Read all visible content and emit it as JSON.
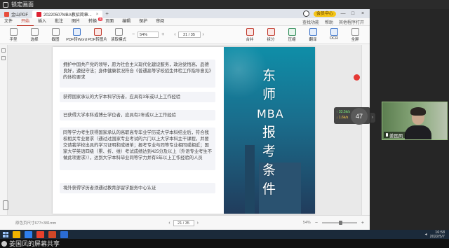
{
  "meeting": {
    "lock_label": "锁定画面",
    "presenter_footer": "姜国凤的屏幕共享"
  },
  "app": {
    "tabs": [
      {
        "label": "金山PDF",
        "active": false
      },
      {
        "label": "20220507MBA教招简章...",
        "active": true
      }
    ],
    "vip_label": "会员中心",
    "menu": [
      {
        "label": "文件",
        "hot": ""
      },
      {
        "label": "开始",
        "hot": "",
        "active": true
      },
      {
        "label": "插入",
        "hot": ""
      },
      {
        "label": "批注",
        "hot": ""
      },
      {
        "label": "图片",
        "hot": ""
      },
      {
        "label": "转换",
        "hot": "热"
      },
      {
        "label": "页面",
        "hot": ""
      },
      {
        "label": "编辑",
        "hot": ""
      },
      {
        "label": "保护",
        "hot": ""
      },
      {
        "label": "审阅",
        "hot": ""
      }
    ],
    "menu_right": [
      "查找功能",
      "帮助",
      "其他程序打开"
    ],
    "toolbar": [
      {
        "label": "手型",
        "icon": "hand-icon",
        "tone": ""
      },
      {
        "label": "选择",
        "icon": "cursor-icon",
        "tone": ""
      },
      {
        "label": "截图",
        "icon": "crop-icon",
        "tone": ""
      },
      {
        "label": "PDF转Word",
        "icon": "word-icon",
        "tone": "blue"
      },
      {
        "label": "PDF转图片",
        "icon": "image-icon",
        "tone": "red"
      },
      {
        "label": "读取模式",
        "icon": "book-icon",
        "tone": ""
      }
    ],
    "zoom_value": "54%",
    "page_value": "21 / 35",
    "toolbar_right": [
      {
        "label": "合并",
        "icon": "merge-icon",
        "tone": "red"
      },
      {
        "label": "拆分",
        "icon": "split-icon",
        "tone": "red"
      },
      {
        "label": "压缩",
        "icon": "compress-icon",
        "tone": "green"
      },
      {
        "label": "翻译",
        "icon": "translate-icon",
        "tone": "blue"
      },
      {
        "label": "OCR",
        "icon": "ocr-icon",
        "tone": "blue"
      },
      {
        "label": "全屏",
        "icon": "fullscreen-icon",
        "tone": ""
      }
    ]
  },
  "document": {
    "cards": [
      {
        "text": "拥护中国共产党的领导，愿为社会主义现代化建设服务，政治觉悟高，品德良好，遵纪守法；身体健康状况符合《普通高等学校招生体检工作指导意见》的体检要求"
      },
      {
        "text": "获得国家承认的大学本科学历者，应具有3年或以上工作经验"
      },
      {
        "text": "已获得大学本科或博士学位者，应具有2年或以上工作经验"
      },
      {
        "text": "同等学力考生获得国家承认的高职高专毕业学历或大学本科结业后，符合我校相关专业要求（通过过国家专业考试的六门以上大学本科主干课程，并要交请我学校出具的学习证明和成绩单；报考专业与同等专业相同或相近；国家大学英语四级（累、折、维）考试成绩达到425分及以上（外语专业考生不做此项要求）），达到大学本科毕业同等学力并有5年以上工作经验的人员"
      },
      {
        "text": "境外获得学历者须通过教育部留学服务中心认证"
      }
    ],
    "banner_title": [
      "东",
      "师",
      "MBA",
      "报",
      "考",
      "条",
      "件"
    ]
  },
  "status": {
    "left": "原色页尺寸677×381mm",
    "page": "21 / 35",
    "zoom": "54%"
  },
  "overlay": {
    "speed_up": "↑ 33.5k/s",
    "speed_down": "↓ 1.6k/s",
    "percent": "47",
    "video_name": "姜国凤"
  },
  "taskbar": {
    "time": "16:58",
    "date": "2022/5/7"
  }
}
